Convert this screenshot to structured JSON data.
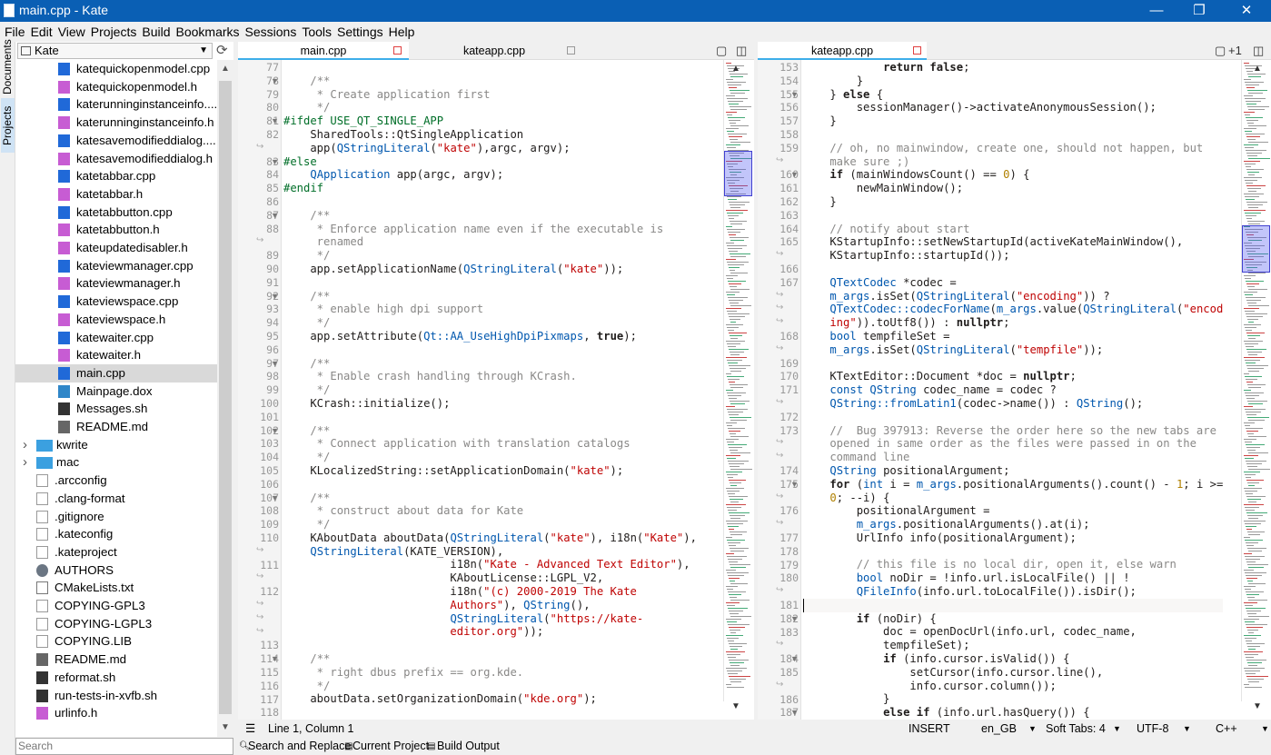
{
  "window": {
    "title": "main.cpp  - Kate",
    "minimize": "—",
    "maximize": "❐",
    "close": "✕"
  },
  "menu": [
    "File",
    "Edit",
    "View",
    "Projects",
    "Build",
    "Bookmarks",
    "Sessions",
    "Tools",
    "Settings",
    "Help"
  ],
  "side_tabs": {
    "documents": "Documents",
    "projects": "Projects"
  },
  "project": {
    "selected": "Kate",
    "search_placeholder": "Search"
  },
  "tree": [
    {
      "label": "katequickopenmodel.cpp",
      "type": "cpp",
      "indent": 1
    },
    {
      "label": "katequickopenmodel.h",
      "type": "h",
      "indent": 1
    },
    {
      "label": "katerunninginstanceinfo....",
      "type": "cpp",
      "indent": 1
    },
    {
      "label": "katerunninginstanceinfo.h",
      "type": "h",
      "indent": 1
    },
    {
      "label": "katesavemodifieddialog....",
      "type": "cpp",
      "indent": 1
    },
    {
      "label": "katesavemodifieddialog.h",
      "type": "h",
      "indent": 1
    },
    {
      "label": "katetabbar.cpp",
      "type": "cpp",
      "indent": 1
    },
    {
      "label": "katetabbar.h",
      "type": "h",
      "indent": 1
    },
    {
      "label": "katetabbutton.cpp",
      "type": "cpp",
      "indent": 1
    },
    {
      "label": "katetabbutton.h",
      "type": "h",
      "indent": 1
    },
    {
      "label": "kateupdatedisabler.h",
      "type": "h",
      "indent": 1
    },
    {
      "label": "kateviewmanager.cpp",
      "type": "cpp",
      "indent": 1
    },
    {
      "label": "kateviewmanager.h",
      "type": "h",
      "indent": 1
    },
    {
      "label": "kateviewspace.cpp",
      "type": "cpp",
      "indent": 1
    },
    {
      "label": "kateviewspace.h",
      "type": "h",
      "indent": 1
    },
    {
      "label": "katewaiter.cpp",
      "type": "cpp",
      "indent": 1
    },
    {
      "label": "katewaiter.h",
      "type": "h",
      "indent": 1
    },
    {
      "label": "main.cpp",
      "type": "cpp",
      "indent": 1,
      "selected": true
    },
    {
      "label": "Mainpage.dox",
      "type": "dox",
      "indent": 1
    },
    {
      "label": "Messages.sh",
      "type": "sh",
      "indent": 1
    },
    {
      "label": "README.md",
      "type": "md",
      "indent": 1
    },
    {
      "label": "kwrite",
      "type": "fold",
      "indent": 0,
      "arrow": true
    },
    {
      "label": "mac",
      "type": "fold",
      "indent": 0,
      "arrow": true
    },
    {
      "label": ".arcconfig",
      "type": "doc",
      "indent": 0
    },
    {
      "label": ".clang-format",
      "type": "doc",
      "indent": 0
    },
    {
      "label": ".gitignore",
      "type": "doc",
      "indent": 0
    },
    {
      "label": ".kateconfig",
      "type": "doc",
      "indent": 0
    },
    {
      "label": ".kateproject",
      "type": "doc",
      "indent": 0
    },
    {
      "label": "AUTHORS",
      "type": "auth",
      "indent": 0
    },
    {
      "label": "CMakeLists.txt",
      "type": "txt",
      "indent": 0
    },
    {
      "label": "COPYING-GPL3",
      "type": "doc",
      "indent": 0
    },
    {
      "label": "COPYING-LGPL3",
      "type": "doc",
      "indent": 0
    },
    {
      "label": "COPYING.LIB",
      "type": "doc",
      "indent": 0
    },
    {
      "label": "README.md",
      "type": "md",
      "indent": 0
    },
    {
      "label": "reformat.sh",
      "type": "sh",
      "indent": 0
    },
    {
      "label": "run-tests-in-xvfb.sh",
      "type": "sh",
      "indent": 0
    },
    {
      "label": "urlinfo.h",
      "type": "h",
      "indent": 0
    }
  ],
  "left_pane": {
    "tabs": [
      {
        "label": "main.cpp",
        "active": true
      },
      {
        "label": "kateapp.cpp",
        "active": false
      }
    ],
    "lines": [
      {
        "n": "77",
        "f": "",
        "t": ""
      },
      {
        "n": "78",
        "f": "▼",
        "t": "    <c>/**</c>"
      },
      {
        "n": "79",
        "f": "",
        "t": "<c>     * Create application first</c>"
      },
      {
        "n": "80",
        "f": "",
        "t": "<c>     */</c>"
      },
      {
        "n": "81",
        "f": "▼",
        "t": "<p>#ifdef USE_QT_SINGLE_APP</p>"
      },
      {
        "n": "82",
        "f": "",
        "t": "    SharedTools::QtSingleApplication"
      },
      {
        "n": "↪",
        "f": "",
        "t": "    app(<y>QStringLiteral</y>(<s>\"kate\"</s>),argc, argv);"
      },
      {
        "n": "83",
        "f": "▼",
        "t": "<p>#else</p>"
      },
      {
        "n": "84",
        "f": "",
        "t": "    <y>QApplication</y> app(argc, argv);"
      },
      {
        "n": "85",
        "f": "",
        "t": "<p>#endif</p>"
      },
      {
        "n": "86",
        "f": "",
        "t": ""
      },
      {
        "n": "87",
        "f": "▼",
        "t": "    <c>/**</c>"
      },
      {
        "n": "88",
        "f": "",
        "t": "<c>     * Enforce application name even if the executable is</c>"
      },
      {
        "n": "↪",
        "f": "",
        "t": "<c>     renamed</c>"
      },
      {
        "n": "89",
        "f": "",
        "t": "<c>     */</c>"
      },
      {
        "n": "90",
        "f": "",
        "t": "    app.setApplicationName(<y>QStringLiteral</y>(<s>\"kate\"</s>));"
      },
      {
        "n": "91",
        "f": "",
        "t": ""
      },
      {
        "n": "92",
        "f": "▼",
        "t": "    <c>/**</c>"
      },
      {
        "n": "93",
        "f": "",
        "t": "<c>     * enable high dpi support</c>"
      },
      {
        "n": "94",
        "f": "",
        "t": "<c>     */</c>"
      },
      {
        "n": "95",
        "f": "",
        "t": "    app.setAttribute(<y>Qt::AA_UseHighDpiPixmaps</y>, <k>true</k>);"
      },
      {
        "n": "96",
        "f": "",
        "t": ""
      },
      {
        "n": "97",
        "f": "▼",
        "t": "    <c>/**</c>"
      },
      {
        "n": "98",
        "f": "",
        "t": "<c>     * Enable crash handling through KCrash.</c>"
      },
      {
        "n": "99",
        "f": "",
        "t": "<c>     */</c>"
      },
      {
        "n": "100",
        "f": "",
        "t": "    KCrash::initialize();"
      },
      {
        "n": "101",
        "f": "",
        "t": ""
      },
      {
        "n": "102",
        "f": "▼",
        "t": "    <c>/**</c>"
      },
      {
        "n": "103",
        "f": "",
        "t": "<c>     * Connect application with translation catalogs</c>"
      },
      {
        "n": "104",
        "f": "",
        "t": "<c>     */</c>"
      },
      {
        "n": "105",
        "f": "",
        "t": "    KLocalizedString::setApplicationDomain(<s>\"kate\"</s>);"
      },
      {
        "n": "106",
        "f": "",
        "t": ""
      },
      {
        "n": "107",
        "f": "▼",
        "t": "    <c>/**</c>"
      },
      {
        "n": "108",
        "f": "",
        "t": "<c>     * construct about data for Kate</c>"
      },
      {
        "n": "109",
        "f": "",
        "t": "<c>     */</c>"
      },
      {
        "n": "110",
        "f": "",
        "t": "    KAboutData aboutData(<y>QStringLiteral</y>(<s>\"kate\"</s>), i18n(<s>\"Kate\"</s>),"
      },
      {
        "n": "↪",
        "f": "",
        "t": "    <y>QStringLiteral</y>(KATE_VERSION),"
      },
      {
        "n": "111",
        "f": "",
        "t": "                         i18n(<s>\"Kate - Advanced Text Editor\"</s>),"
      },
      {
        "n": "↪",
        "f": "",
        "t": "                         KAboutLicense::LGPL_V2,"
      },
      {
        "n": "112",
        "f": "",
        "t": "                         i18n(<s>\"(c) 2000-2019 The Kate</s>"
      },
      {
        "n": "↪",
        "f": "",
        "t": "<s>                         Authors\"</s>), <y>QString</y>(),"
      },
      {
        "n": "↪",
        "f": "",
        "t": "                         <y>QStringLiteral</y>(<s>\"https://kate-</s>"
      },
      {
        "n": "↪",
        "f": "",
        "t": "<s>                         editor.org\"</s>));"
      },
      {
        "n": "113",
        "f": "",
        "t": ""
      },
      {
        "n": "114",
        "f": "▼",
        "t": "    <c>/**</c>"
      },
      {
        "n": "115",
        "f": "",
        "t": "<c>     * right dbus prefix == org.kde.</c>"
      },
      {
        "n": "116",
        "f": "",
        "t": "<c>     */</c>"
      },
      {
        "n": "117",
        "f": "",
        "t": "    aboutData.setOrganizationDomain(<s>\"kde.org\"</s>);"
      },
      {
        "n": "118",
        "f": "",
        "t": ""
      }
    ]
  },
  "right_pane": {
    "tabs": [
      {
        "label": "kateapp.cpp",
        "active": true
      }
    ],
    "extra": "+1",
    "lines": [
      {
        "n": "153",
        "f": "",
        "t": "            <k>return false</k>;"
      },
      {
        "n": "154",
        "f": "",
        "t": "        }"
      },
      {
        "n": "155",
        "f": "▼",
        "t": "    } <k>else</k> {"
      },
      {
        "n": "156",
        "f": "",
        "t": "        sessionManager()->activateAnonymousSession();"
      },
      {
        "n": "157",
        "f": "",
        "t": "    }"
      },
      {
        "n": "158",
        "f": "",
        "t": ""
      },
      {
        "n": "159",
        "f": "",
        "t": "<c>    // oh, no mainwindow, create one, should not happen, but</c>"
      },
      {
        "n": "↪",
        "f": "",
        "t": "<c>    make sure ;)</c>"
      },
      {
        "n": "160",
        "f": "▼",
        "t": "    <k>if</k> (mainWindowsCount() == <n>0</n>) {"
      },
      {
        "n": "161",
        "f": "",
        "t": "        newMainWindow();"
      },
      {
        "n": "162",
        "f": "",
        "t": "    }"
      },
      {
        "n": "163",
        "f": "",
        "t": ""
      },
      {
        "n": "164",
        "f": "",
        "t": "<c>    // notify about start</c>"
      },
      {
        "n": "165",
        "f": "",
        "t": "    KStartupInfo::setNewStartupId(activeKateMainWindow(),"
      },
      {
        "n": "↪",
        "f": "",
        "t": "    KStartupInfo::startupId());"
      },
      {
        "n": "166",
        "f": "",
        "t": ""
      },
      {
        "n": "167",
        "f": "",
        "t": "    <y>QTextCodec</y> *codec ="
      },
      {
        "n": "↪",
        "f": "",
        "t": "    <y>m_args</y>.isSet(<y>QStringLiteral</y>(<s>\"encoding\"</s>)) ?"
      },
      {
        "n": "↪",
        "f": "",
        "t": "    <y>QTextCodec::codecForName</y>(<y>m_args</y>.value(<y>QStringLiteral</y>(<s>\"encod</s>"
      },
      {
        "n": "↪",
        "f": "",
        "t": "<s>    ing\"</s>)).toUtf8()) : <k>nullptr</k>;"
      },
      {
        "n": "168",
        "f": "",
        "t": "    <y>bool</y> tempfileSet ="
      },
      {
        "n": "↪",
        "f": "",
        "t": "    <y>m_args</y>.isSet(<y>QStringLiteral</y>(<s>\"tempfile\"</s>));"
      },
      {
        "n": "169",
        "f": "",
        "t": ""
      },
      {
        "n": "170",
        "f": "",
        "t": "    KTextEditor::Document *doc = <k>nullptr</k>;"
      },
      {
        "n": "171",
        "f": "",
        "t": "    <y>const QString</y> codec_name = codec ?"
      },
      {
        "n": "↪",
        "f": "",
        "t": "    <y>QString::fromLatin1</y>(codec->name()) : <y>QString</y>();"
      },
      {
        "n": "172",
        "f": "",
        "t": ""
      },
      {
        "n": "173",
        "f": "",
        "t": "<c>    //  Bug 397913: Reverse the order here so the new tabs are</c>"
      },
      {
        "n": "↪",
        "f": "",
        "t": "<c>    opened in same order as the files were passed in on the</c>"
      },
      {
        "n": "↪",
        "f": "",
        "t": "<c>    command line</c>"
      },
      {
        "n": "174",
        "f": "",
        "t": "    <y>QString</y> positionalArgument;"
      },
      {
        "n": "175",
        "f": "▼",
        "t": "    <k>for</k> (<y>int</y> i = <y>m_args</y>.positionalArguments().count() - <n>1</n>; i >="
      },
      {
        "n": "↪",
        "f": "",
        "t": "    <n>0</n>; --i) {"
      },
      {
        "n": "176",
        "f": "",
        "t": "        positionalArgument ="
      },
      {
        "n": "↪",
        "f": "",
        "t": "        <y>m_args</y>.positionalArguments().at(i);"
      },
      {
        "n": "177",
        "f": "",
        "t": "        UrlInfo info(positionalArgument);"
      },
      {
        "n": "178",
        "f": "",
        "t": ""
      },
      {
        "n": "179",
        "f": "",
        "t": "<c>        // this file is no local dir, open it, else warn</c>"
      },
      {
        "n": "180",
        "f": "",
        "t": "        <y>bool</y> noDir = !info.url.isLocalFile() || !"
      },
      {
        "n": "↪",
        "f": "",
        "t": "        <y>QFileInfo</y>(info.url.toLocalFile()).isDir();"
      },
      {
        "n": "181",
        "f": "",
        "t": ""
      },
      {
        "n": "182",
        "f": "▼",
        "t": "        <k>if</k> (noDir) {"
      },
      {
        "n": "183",
        "f": "",
        "t": "            doc = openDocUrl(info.url, codec_name,"
      },
      {
        "n": "↪",
        "f": "",
        "t": "            tempfileSet);"
      },
      {
        "n": "184",
        "f": "▼",
        "t": "            <k>if</k> (info.cursor.isValid()) {"
      },
      {
        "n": "185",
        "f": "",
        "t": "                setCursor(info.cursor.line(),"
      },
      {
        "n": "↪",
        "f": "",
        "t": "                info.cursor.column());"
      },
      {
        "n": "186",
        "f": "",
        "t": "            }"
      },
      {
        "n": "187",
        "f": "▼",
        "t": "            <k>else if</k> (info.url.hasQuery()) {"
      }
    ]
  },
  "status": {
    "position": "Line 1, Column 1",
    "mode": "INSERT",
    "lang": "en_GB",
    "indent": "Soft Tabs: 4",
    "encoding": "UTF-8",
    "syntax": "C++"
  },
  "bottom": {
    "search": "Search and Replace",
    "project": "Current Project",
    "build": "Build Output"
  }
}
